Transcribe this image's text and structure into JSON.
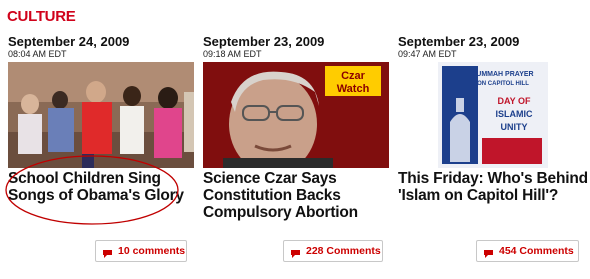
{
  "section": {
    "title": "CULTURE"
  },
  "articles": [
    {
      "date": "September 24, 2009",
      "time": "08:04 AM EDT",
      "headline": "School Children Sing Songs of Obama's Glory",
      "comments": "10 comments"
    },
    {
      "date": "September 23, 2009",
      "time": "09:18 AM EDT",
      "headline": "Science Czar Says Constitution Backs Compulsory Abortion",
      "comments": "228 Comments",
      "thumb_badge": [
        "Czar",
        "Watch"
      ]
    },
    {
      "date": "September 23, 2009",
      "time": "09:47 AM EDT",
      "headline": "This Friday: Who's Behind 'Islam on Capitol Hill'?",
      "comments": "454 Comments",
      "thumb_text": [
        "JUMMAH PRAYER",
        "ON CAPITOL HILL",
        "DAY OF",
        "ISLAMIC",
        "UNITY"
      ]
    }
  ],
  "colors": {
    "accent": "#d0021b",
    "comment_red": "#cc0000",
    "annotation": "#c00000"
  },
  "icons": {
    "comment": "speech-bubble-icon"
  }
}
